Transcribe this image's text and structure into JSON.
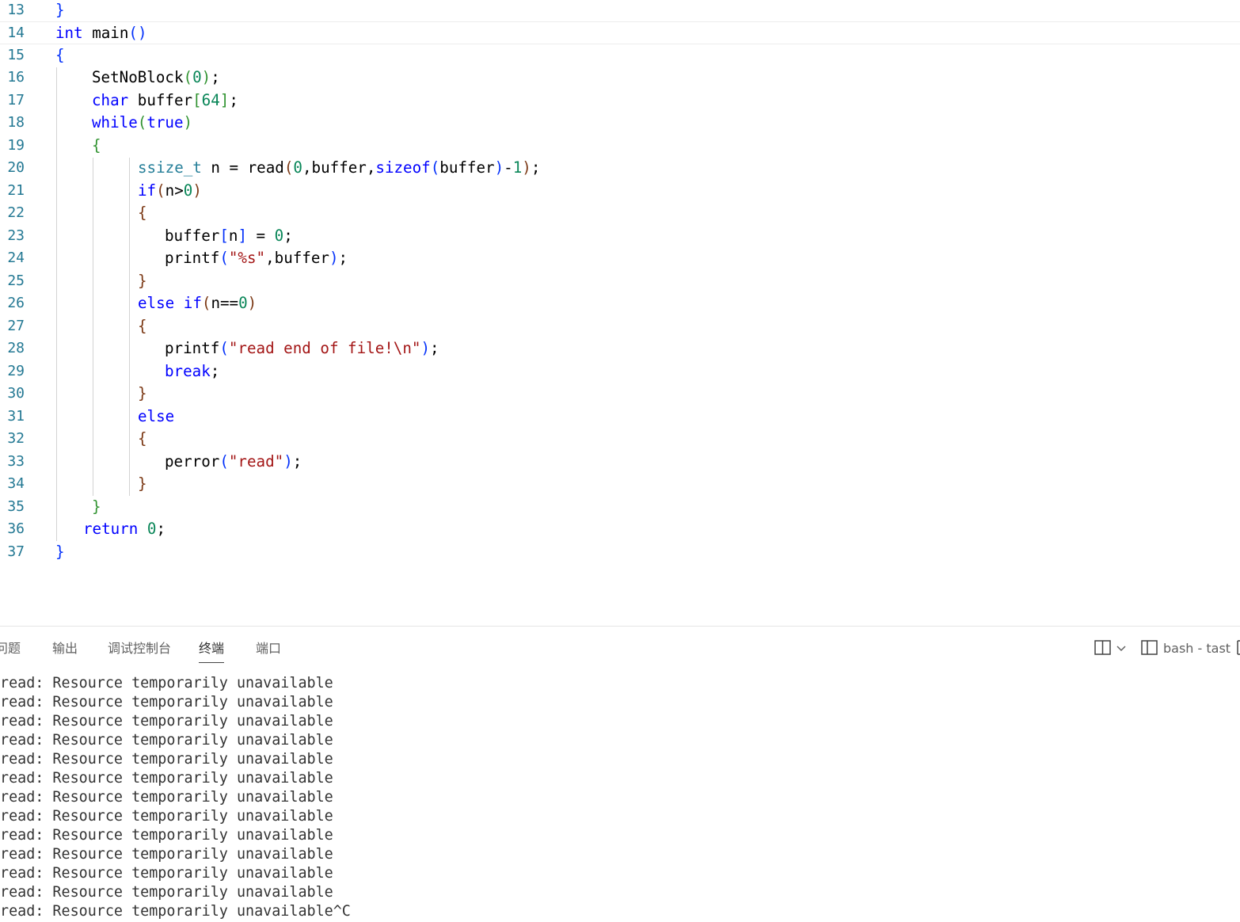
{
  "editor": {
    "lines": [
      {
        "n": "13",
        "indent": 0,
        "tokens": [
          {
            "t": "}",
            "c": "br1"
          }
        ]
      },
      {
        "n": "14",
        "indent": 0,
        "current": true,
        "tokens": [
          {
            "t": "int",
            "c": "kw"
          },
          {
            "t": " main",
            "c": ""
          },
          {
            "t": "()",
            "c": "br1"
          }
        ]
      },
      {
        "n": "15",
        "indent": 0,
        "tokens": [
          {
            "t": "{",
            "c": "br1"
          }
        ]
      },
      {
        "n": "16",
        "indent": 46,
        "tokens": [
          {
            "t": "SetNoBlock",
            "c": ""
          },
          {
            "t": "(",
            "c": "br2"
          },
          {
            "t": "0",
            "c": "num"
          },
          {
            "t": ")",
            "c": "br2"
          },
          {
            "t": ";",
            "c": ""
          }
        ]
      },
      {
        "n": "17",
        "indent": 46,
        "tokens": [
          {
            "t": "char",
            "c": "kw"
          },
          {
            "t": " buffer",
            "c": ""
          },
          {
            "t": "[",
            "c": "br2"
          },
          {
            "t": "64",
            "c": "num"
          },
          {
            "t": "]",
            "c": "br2"
          },
          {
            "t": ";",
            "c": ""
          }
        ]
      },
      {
        "n": "18",
        "indent": 46,
        "tokens": [
          {
            "t": "while",
            "c": "kw"
          },
          {
            "t": "(",
            "c": "br2"
          },
          {
            "t": "true",
            "c": "kw"
          },
          {
            "t": ")",
            "c": "br2"
          }
        ]
      },
      {
        "n": "19",
        "indent": 46,
        "tokens": [
          {
            "t": "{",
            "c": "br2"
          }
        ]
      },
      {
        "n": "20",
        "indent": 104,
        "tokens": [
          {
            "t": "ssize_t",
            "c": "ty"
          },
          {
            "t": " n = read",
            "c": ""
          },
          {
            "t": "(",
            "c": "br3"
          },
          {
            "t": "0",
            "c": "num"
          },
          {
            "t": ",buffer,",
            "c": ""
          },
          {
            "t": "sizeof",
            "c": "kw"
          },
          {
            "t": "(",
            "c": "br1"
          },
          {
            "t": "buffer",
            "c": ""
          },
          {
            "t": ")",
            "c": "br1"
          },
          {
            "t": "-",
            "c": ""
          },
          {
            "t": "1",
            "c": "num"
          },
          {
            "t": ")",
            "c": "br3"
          },
          {
            "t": ";",
            "c": ""
          }
        ]
      },
      {
        "n": "21",
        "indent": 104,
        "tokens": [
          {
            "t": "if",
            "c": "kw"
          },
          {
            "t": "(",
            "c": "br3"
          },
          {
            "t": "n>",
            "c": ""
          },
          {
            "t": "0",
            "c": "num"
          },
          {
            "t": ")",
            "c": "br3"
          }
        ]
      },
      {
        "n": "22",
        "indent": 104,
        "tokens": [
          {
            "t": "{",
            "c": "br3"
          }
        ]
      },
      {
        "n": "23",
        "indent": 138,
        "tokens": [
          {
            "t": "buffer",
            "c": ""
          },
          {
            "t": "[",
            "c": "br1"
          },
          {
            "t": "n",
            "c": ""
          },
          {
            "t": "]",
            "c": "br1"
          },
          {
            "t": " = ",
            "c": ""
          },
          {
            "t": "0",
            "c": "num"
          },
          {
            "t": ";",
            "c": ""
          }
        ]
      },
      {
        "n": "24",
        "indent": 138,
        "tokens": [
          {
            "t": "printf",
            "c": ""
          },
          {
            "t": "(",
            "c": "br1"
          },
          {
            "t": "\"%s\"",
            "c": "str"
          },
          {
            "t": ",buffer",
            "c": ""
          },
          {
            "t": ")",
            "c": "br1"
          },
          {
            "t": ";",
            "c": ""
          }
        ]
      },
      {
        "n": "25",
        "indent": 104,
        "tokens": [
          {
            "t": "}",
            "c": "br3"
          }
        ]
      },
      {
        "n": "26",
        "indent": 104,
        "tokens": [
          {
            "t": "else",
            "c": "kw"
          },
          {
            "t": " ",
            "c": ""
          },
          {
            "t": "if",
            "c": "kw"
          },
          {
            "t": "(",
            "c": "br3"
          },
          {
            "t": "n==",
            "c": ""
          },
          {
            "t": "0",
            "c": "num"
          },
          {
            "t": ")",
            "c": "br3"
          }
        ]
      },
      {
        "n": "27",
        "indent": 104,
        "tokens": [
          {
            "t": "{",
            "c": "br3"
          }
        ]
      },
      {
        "n": "28",
        "indent": 138,
        "tokens": [
          {
            "t": "printf",
            "c": ""
          },
          {
            "t": "(",
            "c": "br1"
          },
          {
            "t": "\"read end of file!\\n\"",
            "c": "str"
          },
          {
            "t": ")",
            "c": "br1"
          },
          {
            "t": ";",
            "c": ""
          }
        ]
      },
      {
        "n": "29",
        "indent": 138,
        "tokens": [
          {
            "t": "break",
            "c": "kw"
          },
          {
            "t": ";",
            "c": ""
          }
        ]
      },
      {
        "n": "30",
        "indent": 104,
        "tokens": [
          {
            "t": "}",
            "c": "br3"
          }
        ]
      },
      {
        "n": "31",
        "indent": 104,
        "tokens": [
          {
            "t": "else",
            "c": "kw"
          }
        ]
      },
      {
        "n": "32",
        "indent": 104,
        "tokens": [
          {
            "t": "{",
            "c": "br3"
          }
        ]
      },
      {
        "n": "33",
        "indent": 138,
        "tokens": [
          {
            "t": "perror",
            "c": ""
          },
          {
            "t": "(",
            "c": "br1"
          },
          {
            "t": "\"read\"",
            "c": "str"
          },
          {
            "t": ")",
            "c": "br1"
          },
          {
            "t": ";",
            "c": ""
          }
        ]
      },
      {
        "n": "34",
        "indent": 104,
        "tokens": [
          {
            "t": "}",
            "c": "br3"
          }
        ]
      },
      {
        "n": "35",
        "indent": 46,
        "tokens": [
          {
            "t": "}",
            "c": "br2"
          }
        ]
      },
      {
        "n": "36",
        "indent": 35,
        "tokens": [
          {
            "t": "return",
            "c": "kw"
          },
          {
            "t": " ",
            "c": ""
          },
          {
            "t": "0",
            "c": "num"
          },
          {
            "t": ";",
            "c": ""
          }
        ]
      },
      {
        "n": "37",
        "indent": 0,
        "tokens": [
          {
            "t": "}",
            "c": "br1"
          }
        ]
      }
    ]
  },
  "panel": {
    "tabs": [
      {
        "label": "问题",
        "name": "tab-problems"
      },
      {
        "label": "输出",
        "name": "tab-output"
      },
      {
        "label": "调试控制台",
        "name": "tab-debug-console"
      },
      {
        "label": "终端",
        "name": "tab-terminal",
        "active": true
      },
      {
        "label": "端口",
        "name": "tab-ports"
      }
    ],
    "terminal_name": "bash - tast",
    "icons": {
      "split": "split-editor-icon",
      "chevron": "chevron-down-icon",
      "terminal": "terminal-icon"
    }
  },
  "terminal": {
    "lines": [
      "read: Resource temporarily unavailable",
      "read: Resource temporarily unavailable",
      "read: Resource temporarily unavailable",
      "read: Resource temporarily unavailable",
      "read: Resource temporarily unavailable",
      "read: Resource temporarily unavailable",
      "read: Resource temporarily unavailable",
      "read: Resource temporarily unavailable",
      "read: Resource temporarily unavailable",
      "read: Resource temporarily unavailable",
      "read: Resource temporarily unavailable",
      "read: Resource temporarily unavailable",
      "read: Resource temporarily unavailable^C"
    ]
  }
}
